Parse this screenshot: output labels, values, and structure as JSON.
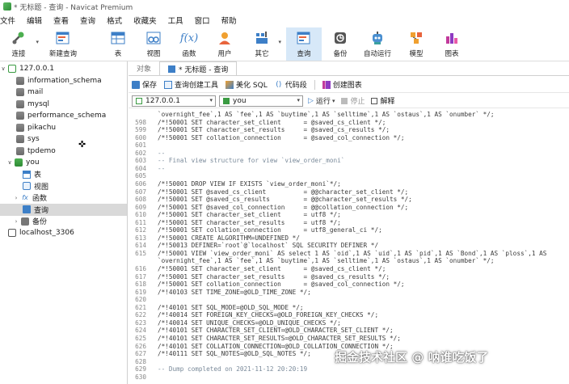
{
  "window": {
    "title": "* 无标题 - 查询 - Navicat Premium"
  },
  "menu": [
    "文件",
    "编辑",
    "查看",
    "查询",
    "格式",
    "收藏夹",
    "工具",
    "窗口",
    "帮助"
  ],
  "toolbar": [
    {
      "label": "连接",
      "icon": "connection-icon"
    },
    {
      "label": "新建查询",
      "icon": "new-query-icon"
    },
    {
      "label": "表",
      "icon": "table-icon"
    },
    {
      "label": "视图",
      "icon": "view-icon"
    },
    {
      "label": "函数",
      "icon": "function-icon",
      "glyph": "f(x)"
    },
    {
      "label": "用户",
      "icon": "user-icon"
    },
    {
      "label": "其它",
      "icon": "other-icon"
    },
    {
      "label": "查询",
      "icon": "query-icon"
    },
    {
      "label": "备份",
      "icon": "backup-icon"
    },
    {
      "label": "自动运行",
      "icon": "automation-icon"
    },
    {
      "label": "模型",
      "icon": "model-icon"
    },
    {
      "label": "图表",
      "icon": "chart-icon"
    }
  ],
  "sidebar": {
    "items": [
      {
        "label": "127.0.0.1",
        "icon": "connection-green-icon",
        "toggle": "∨"
      },
      {
        "label": "information_schema",
        "icon": "database-icon"
      },
      {
        "label": "mail",
        "icon": "database-icon"
      },
      {
        "label": "mysql",
        "icon": "database-icon"
      },
      {
        "label": "performance_schema",
        "icon": "database-icon"
      },
      {
        "label": "pikachu",
        "icon": "database-icon"
      },
      {
        "label": "sys",
        "icon": "database-icon"
      },
      {
        "label": "tpdemo",
        "icon": "database-icon"
      },
      {
        "label": "you",
        "icon": "database-green-icon",
        "toggle": "∨"
      },
      {
        "label": "表",
        "icon": "table-icon"
      },
      {
        "label": "视图",
        "icon": "view-icon"
      },
      {
        "label": "函数",
        "icon": "function-icon",
        "toggle": "›"
      },
      {
        "label": "查询",
        "icon": "query-icon",
        "selected": true
      },
      {
        "label": "备份",
        "icon": "backup-icon",
        "toggle": "›"
      },
      {
        "label": "localhost_3306",
        "icon": "connection-gray-icon"
      }
    ]
  },
  "tabs": [
    {
      "label": "对象",
      "active": false
    },
    {
      "label": "* 无标题 - 查询",
      "active": true
    }
  ],
  "query_toolbar": {
    "save": "保存",
    "query_builder": "查询创建工具",
    "beautify": "美化 SQL",
    "snippet": "代码段",
    "create_chart": "创建图表"
  },
  "sql_bar": {
    "connection": "127.0.0.1",
    "database": "you",
    "run": "运行",
    "stop": "停止",
    "explain": "解释"
  },
  "editor": {
    "lines": [
      {
        "n": "",
        "t": "`overnight_fee`,1 AS `fee`,1 AS `buytime`,1 AS `selltime`,1 AS `ostaus`,1 AS `onumber` */;"
      },
      {
        "n": "598",
        "t": "/*!50001 SET character_set_client      = @saved_cs_client */;"
      },
      {
        "n": "599",
        "t": "/*!50001 SET character_set_results     = @saved_cs_results */;"
      },
      {
        "n": "600",
        "t": "/*!50001 SET collation_connection      = @saved_col_connection */;"
      },
      {
        "n": "601",
        "t": ""
      },
      {
        "n": "602",
        "t": "--",
        "comment": true
      },
      {
        "n": "603",
        "t": "-- Final view structure for view `view_order_moni`",
        "comment": true
      },
      {
        "n": "604",
        "t": "--",
        "comment": true
      },
      {
        "n": "605",
        "t": ""
      },
      {
        "n": "606",
        "t": "/*!50001 DROP VIEW IF EXISTS `view_order_moni`*/;"
      },
      {
        "n": "607",
        "t": "/*!50001 SET @saved_cs_client          = @@character_set_client */;"
      },
      {
        "n": "608",
        "t": "/*!50001 SET @saved_cs_results         = @@character_set_results */;"
      },
      {
        "n": "609",
        "t": "/*!50001 SET @saved_col_connection     = @@collation_connection */;"
      },
      {
        "n": "610",
        "t": "/*!50001 SET character_set_client      = utf8 */;"
      },
      {
        "n": "611",
        "t": "/*!50001 SET character_set_results     = utf8 */;"
      },
      {
        "n": "612",
        "t": "/*!50001 SET collation_connection      = utf8_general_ci */;"
      },
      {
        "n": "613",
        "t": "/*!50001 CREATE ALGORITHM=UNDEFINED */"
      },
      {
        "n": "614",
        "t": "/*!50013 DEFINER=`root`@`localhost` SQL SECURITY DEFINER */"
      },
      {
        "n": "615",
        "t": "/*!50001 VIEW `view_order_moni` AS select 1 AS `oid`,1 AS `uid`,1 AS `pid`,1 AS `Bond`,1 AS `ploss`,1 AS"
      },
      {
        "n": "",
        "t": "`overnight_fee`,1 AS `fee`,1 AS `buytime`,1 AS `selltime`,1 AS `ostaus`,1 AS `onumber` */;"
      },
      {
        "n": "616",
        "t": "/*!50001 SET character_set_client      = @saved_cs_client */;"
      },
      {
        "n": "617",
        "t": "/*!50001 SET character_set_results     = @saved_cs_results */;"
      },
      {
        "n": "618",
        "t": "/*!50001 SET collation_connection      = @saved_col_connection */;"
      },
      {
        "n": "619",
        "t": "/*!40103 SET TIME_ZONE=@OLD_TIME_ZONE */;"
      },
      {
        "n": "620",
        "t": ""
      },
      {
        "n": "621",
        "t": "/*!40101 SET SQL_MODE=@OLD_SQL_MODE */;"
      },
      {
        "n": "622",
        "t": "/*!40014 SET FOREIGN_KEY_CHECKS=@OLD_FOREIGN_KEY_CHECKS */;"
      },
      {
        "n": "623",
        "t": "/*!40014 SET UNIQUE_CHECKS=@OLD_UNIQUE_CHECKS */;"
      },
      {
        "n": "624",
        "t": "/*!40101 SET CHARACTER_SET_CLIENT=@OLD_CHARACTER_SET_CLIENT */;"
      },
      {
        "n": "625",
        "t": "/*!40101 SET CHARACTER_SET_RESULTS=@OLD_CHARACTER_SET_RESULTS */;"
      },
      {
        "n": "626",
        "t": "/*!40101 SET COLLATION_CONNECTION=@OLD_COLLATION_CONNECTION */;"
      },
      {
        "n": "627",
        "t": "/*!40111 SET SQL_NOTES=@OLD_SQL_NOTES */;"
      },
      {
        "n": "628",
        "t": ""
      },
      {
        "n": "629",
        "t": "-- Dump completed on 2021-11-12 20:20:19",
        "comment": true
      },
      {
        "n": "630",
        "t": ""
      }
    ]
  },
  "watermark": "掘金技术社区 @ 呐谁吃饭了"
}
